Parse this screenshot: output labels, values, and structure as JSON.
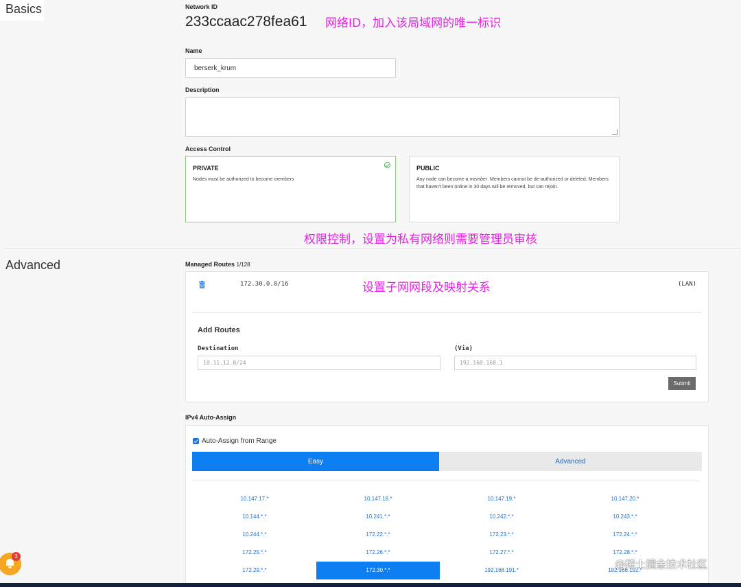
{
  "basics": {
    "title": "Basics",
    "network_id_label": "Network ID",
    "network_id": "233ccaac278fea61",
    "network_id_note": "网络ID，加入该局域网的唯一标识",
    "name_label": "Name",
    "name_value": "berserk_krum",
    "description_label": "Description",
    "description_value": "",
    "access_label": "Access Control",
    "private_title": "PRIVATE",
    "private_desc_pre": "Nodes must be authorized to become ",
    "private_desc_em": "members",
    "public_title": "PUBLIC",
    "public_desc_pre": "Any node can become a ",
    "public_desc_em": "member",
    "public_desc_post": ". Members cannot be de-authorized or deleted. Members that haven't been online in 30 days will be removed, but can rejoin.",
    "access_note": "权限控制，设置为私有网络则需要管理员审核"
  },
  "advanced": {
    "title": "Advanced",
    "routes_label": "Managed Routes",
    "routes_count": "1/128",
    "route": {
      "target": "172.30.0.0/16",
      "via": "(LAN)"
    },
    "routes_note": "设置子网网段及映射关系",
    "add_routes_title": "Add Routes",
    "destination_label": "Destination",
    "destination_placeholder": "10.11.12.0/24",
    "via_label": "(Via)",
    "via_placeholder": "192.168.168.1",
    "submit_label": "Submit",
    "ipv4_label": "IPv4 Auto-Assign",
    "auto_assign_label": "Auto-Assign from Range",
    "auto_assign_checked": true,
    "tabs": [
      "Easy",
      "Advanced"
    ],
    "ranges": [
      [
        "10.147.17.*",
        "10.147.18.*",
        "10.147.19.*",
        "10.147.20.*"
      ],
      [
        "10.144.*.*",
        "10.241.*.*",
        "10.242.*.*",
        "10.243.*.*"
      ],
      [
        "10.244.*.*",
        "172.22.*.*",
        "172.23.*.*",
        "172.24.*.*"
      ],
      [
        "172.25.*.*",
        "172.26.*.*",
        "172.27.*.*",
        "172.28.*.*"
      ],
      [
        "172.29.*.*",
        "172.30.*.*",
        "192.168.191.*",
        "192.168.192.*"
      ]
    ],
    "selected_range": "172.30.*.*"
  },
  "notification": {
    "count": "3"
  },
  "watermark": "@稀土掘金技术社区",
  "colors": {
    "accent": "#0d7ff2",
    "annotation": "#e622e6",
    "private_border": "#8ccf7e"
  }
}
